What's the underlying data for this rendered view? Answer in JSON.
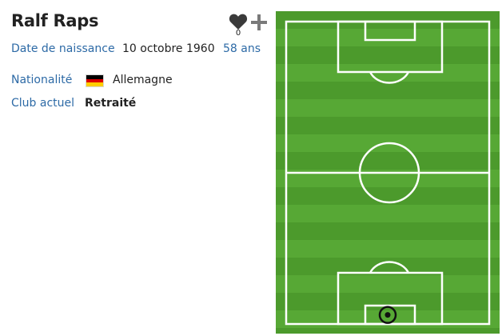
{
  "player": {
    "name": "Ralf Raps",
    "favorites_count": "0"
  },
  "info": {
    "birth_label": "Date de naissance",
    "birth_date": "10 octobre 1960",
    "age": "58 ans",
    "nationality_label": "Nationalité",
    "nationality": "Allemagne",
    "club_label": "Club actuel",
    "club": "Retraité"
  },
  "icons": {
    "favorite": "heart-icon",
    "add": "plus-icon",
    "flag": "germany-flag-icon",
    "position_marker": "circle-marker-icon"
  },
  "colors": {
    "link": "#2d6aa6",
    "text": "#222222",
    "icon": "#7a7a7a",
    "grass_light": "#5fb13a",
    "grass_dark": "#4c9a2c",
    "pitch_lines": "#ffffff",
    "flag_black": "#000000",
    "flag_red": "#dd0000",
    "flag_gold": "#ffce00"
  },
  "pitch": {
    "position_marker": {
      "depth": 0.97,
      "side": 0.5
    }
  }
}
